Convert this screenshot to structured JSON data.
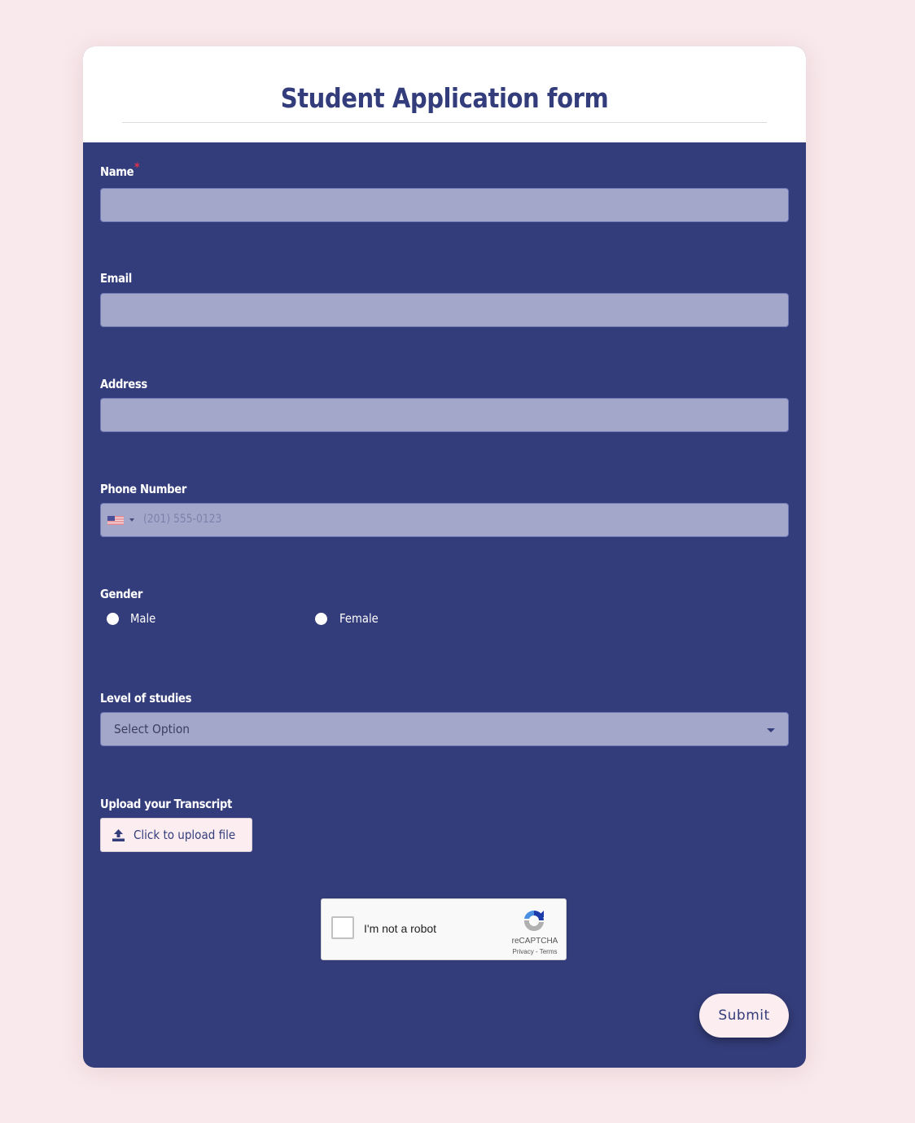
{
  "form": {
    "title": "Student Application form",
    "fields": {
      "name": {
        "label": "Name",
        "required_marker": "*",
        "value": ""
      },
      "email": {
        "label": "Email",
        "value": ""
      },
      "address": {
        "label": "Address",
        "value": ""
      },
      "phone": {
        "label": "Phone Number",
        "country": "US",
        "placeholder": "(201) 555-0123",
        "value": ""
      },
      "gender": {
        "label": "Gender",
        "options": [
          "Male",
          "Female"
        ],
        "selected": null
      },
      "level": {
        "label": "Level of studies",
        "selected": "Select Option"
      },
      "transcript": {
        "label": "Upload your Transcript",
        "button_label": "Click to upload file"
      }
    },
    "captcha": {
      "label": "I'm not a robot",
      "brand": "reCAPTCHA",
      "links": "Privacy - Terms",
      "checked": false
    },
    "submit_label": "Submit"
  },
  "colors": {
    "primary": "#343d7b",
    "background": "#f9e9ec",
    "input": "#a3a8cb",
    "required": "#e0314b"
  }
}
